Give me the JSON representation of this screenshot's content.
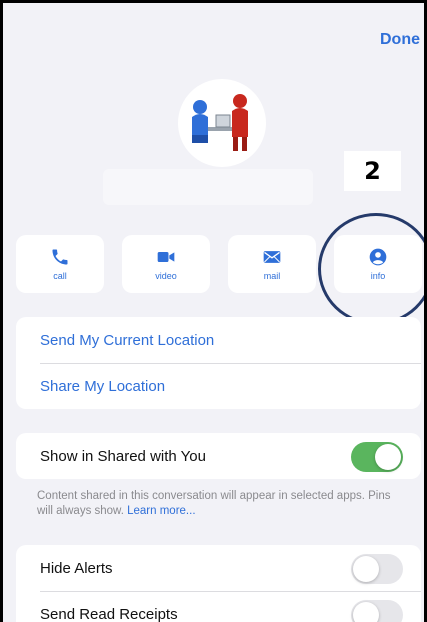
{
  "header": {
    "done_label": "Done"
  },
  "annotation": {
    "step_number": "2"
  },
  "actions": [
    {
      "label": "call",
      "icon": "phone-icon"
    },
    {
      "label": "video",
      "icon": "video-camera-icon"
    },
    {
      "label": "mail",
      "icon": "envelope-icon"
    },
    {
      "label": "info",
      "icon": "person-icon"
    }
  ],
  "location": {
    "send_current": "Send My Current Location",
    "share": "Share My Location"
  },
  "shared": {
    "label": "Show in Shared with You",
    "enabled": true,
    "footnote": "Content shared in this conversation will appear in selected apps. Pins will always show.",
    "learn_more": "Learn more..."
  },
  "settings": {
    "hide_alerts": "Hide Alerts",
    "hide_alerts_enabled": false,
    "read_receipts": "Send Read Receipts",
    "read_receipts_enabled": false
  },
  "colors": {
    "accent": "#2f6fd8",
    "toggle_on": "#5ab55e",
    "highlight_ring": "#253a6a"
  }
}
